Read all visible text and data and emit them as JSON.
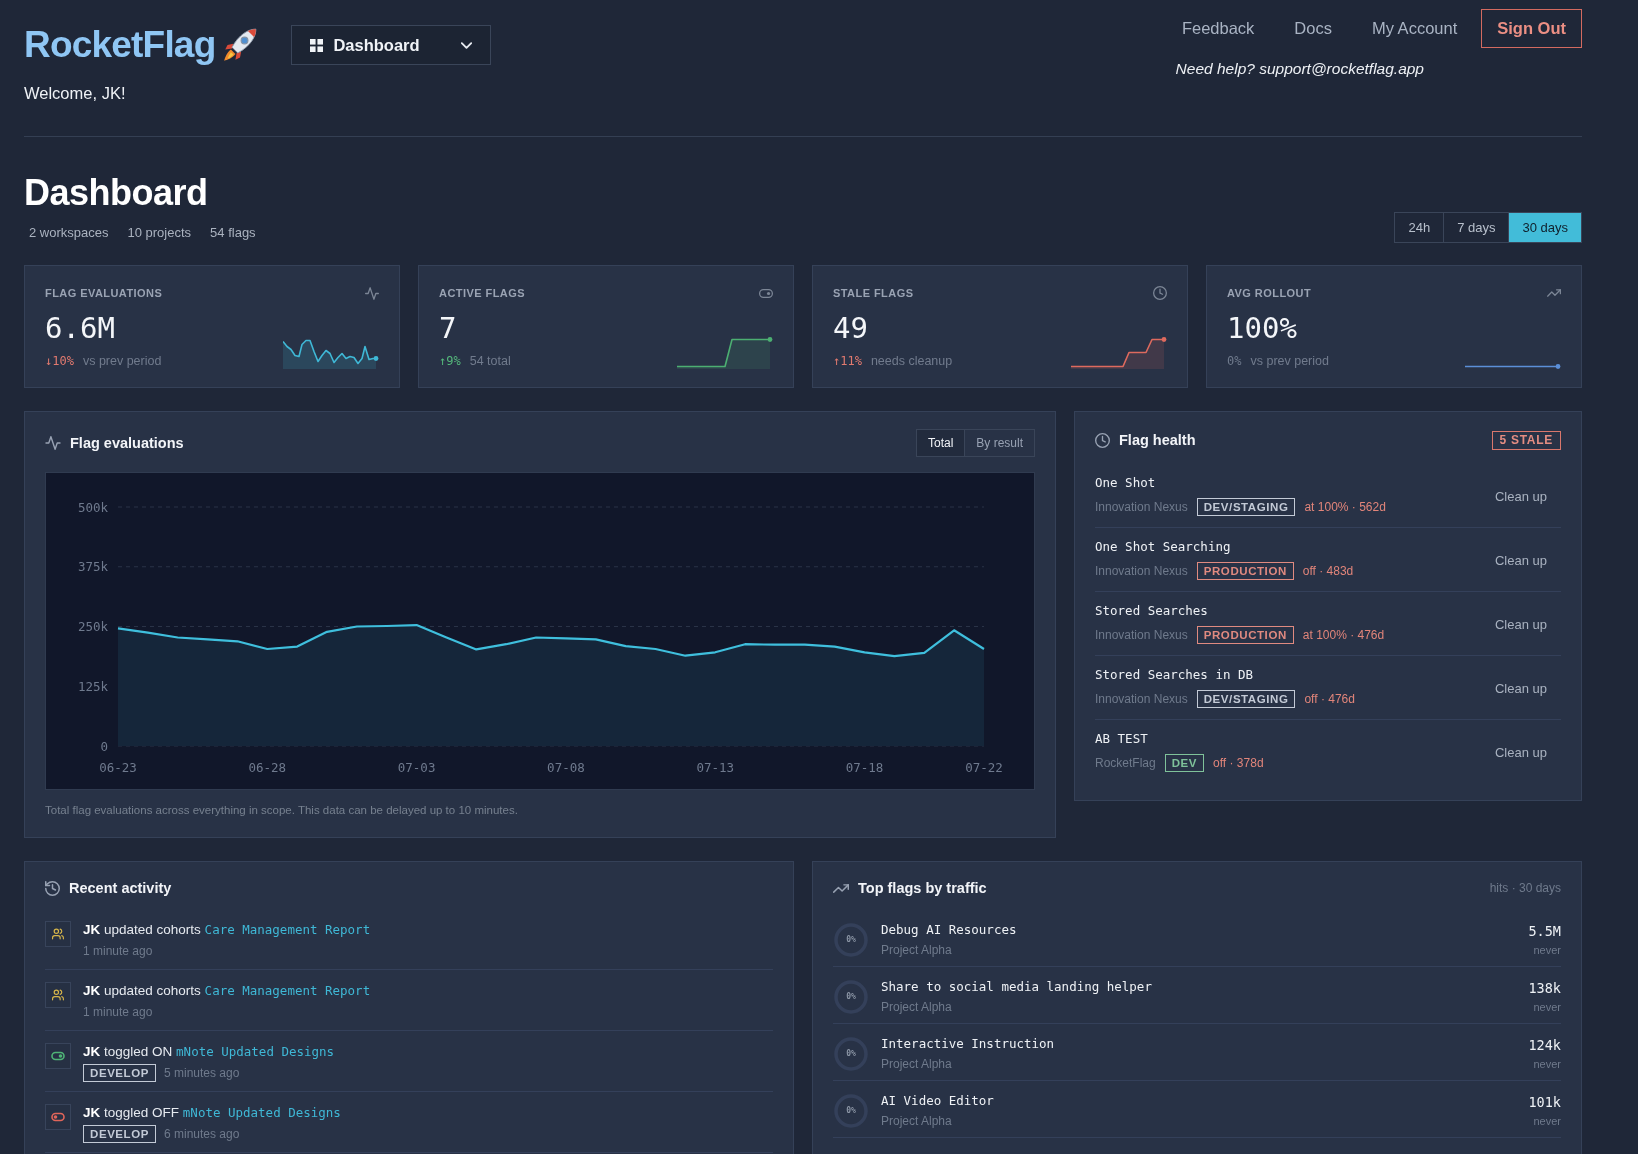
{
  "header": {
    "logo": "RocketFlag",
    "view_menu": {
      "label": "Dashboard"
    },
    "welcome": "Welcome, JK!",
    "nav": [
      {
        "label": "Feedback",
        "kind": "link"
      },
      {
        "label": "Docs",
        "kind": "link"
      },
      {
        "label": "My Account",
        "kind": "link"
      },
      {
        "label": "Sign Out",
        "kind": "button"
      }
    ],
    "help": "Need help? support@rocketflag.app"
  },
  "page": {
    "title": "Dashboard",
    "counts": [
      "2 workspaces",
      "10 projects",
      "54 flags"
    ],
    "ranges": [
      {
        "label": "24h",
        "selected": false
      },
      {
        "label": "7 days",
        "selected": false
      },
      {
        "label": "30 days",
        "selected": true
      }
    ]
  },
  "stats": [
    {
      "label": "FLAG EVALUATIONS",
      "value": "6.6M",
      "delta": "↓10%",
      "color": "#e27a6f",
      "note": "vs prev period"
    },
    {
      "label": "ACTIVE FLAGS",
      "value": "7",
      "delta": "↑9%",
      "color": "#55b97b",
      "note": "54 total"
    },
    {
      "label": "STALE FLAGS",
      "value": "49",
      "delta": "↑11%",
      "color": "#e27a6f",
      "note": "needs cleanup"
    },
    {
      "label": "AVG ROLLOUT",
      "value": "100%",
      "delta": "0%",
      "color": "#6f7a8c",
      "note": "vs prev period"
    }
  ],
  "evaluations": {
    "title": "Flag evaluations",
    "modes": [
      {
        "label": "Total",
        "selected": true
      },
      {
        "label": "By result",
        "selected": false
      }
    ],
    "chart_data": {
      "type": "area",
      "categories": [
        "06-23",
        null,
        null,
        null,
        null,
        "06-28",
        null,
        null,
        null,
        null,
        "07-03",
        null,
        null,
        null,
        null,
        "07-08",
        null,
        null,
        null,
        null,
        "07-13",
        null,
        null,
        null,
        null,
        "07-18",
        null,
        null,
        null,
        "07-22"
      ],
      "values": [
        246000,
        237000,
        227000,
        223000,
        219000,
        203000,
        208000,
        239000,
        250000,
        251000,
        253000,
        227000,
        202000,
        213000,
        227000,
        225000,
        223000,
        209000,
        203000,
        189000,
        196000,
        213000,
        212000,
        212000,
        208000,
        196000,
        188000,
        195000,
        242000,
        203000
      ],
      "ylim": [
        0,
        500000
      ],
      "yticks": [
        {
          "value": 0,
          "label": "0"
        },
        {
          "value": 125000,
          "label": "125k"
        },
        {
          "value": 250000,
          "label": "250k"
        },
        {
          "value": 375000,
          "label": "375k"
        },
        {
          "value": 500000,
          "label": "500k"
        }
      ]
    },
    "footnote": "Total flag evaluations across everything in scope. This data can be delayed up to 10 minutes."
  },
  "flag_health": {
    "title": "Flag health",
    "badge": "5 STALE",
    "items": [
      {
        "name": "One Shot",
        "project": "Innovation Nexus",
        "env": {
          "label": "DEV/STAGING",
          "color": "#c3cad6"
        },
        "status": "at 100% · 562d",
        "action": "Clean up"
      },
      {
        "name": "One Shot Searching",
        "project": "Innovation Nexus",
        "env": {
          "label": "PRODUCTION",
          "color": "#e08a80"
        },
        "status": "off · 483d",
        "action": "Clean up"
      },
      {
        "name": "Stored Searches",
        "project": "Innovation Nexus",
        "env": {
          "label": "PRODUCTION",
          "color": "#e08a80"
        },
        "status": "at 100% · 476d",
        "action": "Clean up"
      },
      {
        "name": "Stored Searches in DB",
        "project": "Innovation Nexus",
        "env": {
          "label": "DEV/STAGING",
          "color": "#c3cad6"
        },
        "status": "off · 476d",
        "action": "Clean up"
      },
      {
        "name": "AB TEST",
        "project": "RocketFlag",
        "env": {
          "label": "DEV",
          "color": "#7fc29a"
        },
        "status": "off · 378d",
        "action": "Clean up"
      }
    ]
  },
  "recent_activity": {
    "title": "Recent activity",
    "items": [
      {
        "kind": "cohorts",
        "text": "**JK** updated cohorts",
        "link": "Care Management Report",
        "time": "1 minute ago"
      },
      {
        "kind": "cohorts",
        "text": "**JK** updated cohorts",
        "link": "Care Management Report",
        "time": "1 minute ago"
      },
      {
        "kind": "toggle_on",
        "text": "**JK** toggled ON",
        "link": "mNote Updated Designs",
        "env": {
          "label": "DEVELOP",
          "color": "#c3cad6"
        },
        "time": "5 minutes ago"
      },
      {
        "kind": "toggle_off",
        "text": "**JK** toggled OFF",
        "link": "mNote Updated Designs",
        "env": {
          "label": "DEVELOP",
          "color": "#c3cad6"
        },
        "time": "6 minutes ago"
      }
    ]
  },
  "top_flags": {
    "title": "Top flags by traffic",
    "note": "hits · 30 days",
    "items": [
      {
        "name": "Debug AI Resources",
        "project": "Project Alpha",
        "rollout": "0%",
        "level": 0,
        "hits": "5.5M",
        "last": "never"
      },
      {
        "name": "Share to social media landing helper",
        "project": "Project Alpha",
        "rollout": "0%",
        "level": 0,
        "hits": "138k",
        "last": "never"
      },
      {
        "name": "Interactive Instruction",
        "project": "Project Alpha",
        "rollout": "0%",
        "level": 0,
        "hits": "124k",
        "last": "never"
      },
      {
        "name": "AI Video Editor",
        "project": "Project Alpha",
        "rollout": "0%",
        "level": 0,
        "hits": "101k",
        "last": "never"
      }
    ]
  }
}
